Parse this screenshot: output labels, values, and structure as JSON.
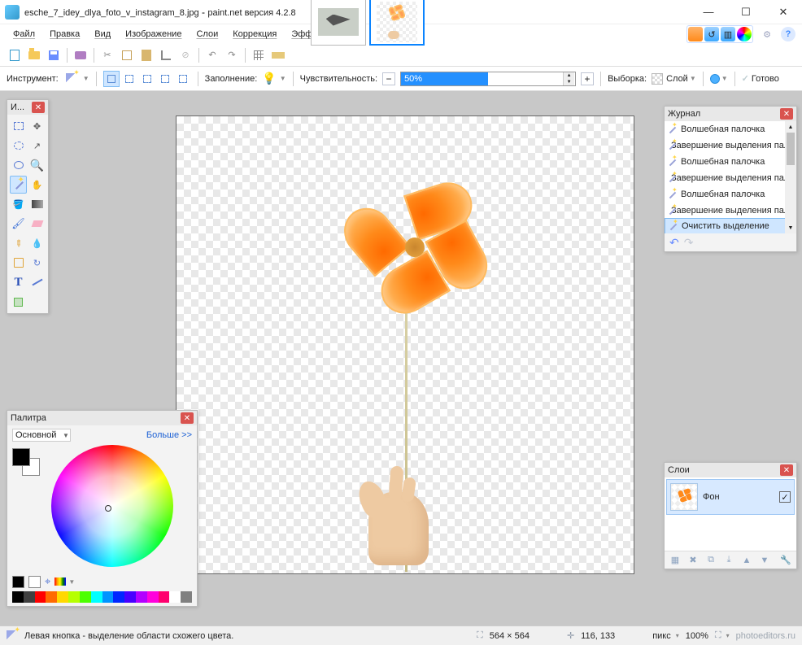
{
  "titlebar": {
    "filename": "esche_7_idey_dlya_foto_v_instagram_8.jpg",
    "app": "paint.net версия 4.2.8"
  },
  "menu": {
    "file": "Файл",
    "edit": "Правка",
    "view": "Вид",
    "image": "Изображение",
    "layers": "Слои",
    "correction": "Коррекция",
    "effects": "Эффекты"
  },
  "options": {
    "tool_label": "Инструмент:",
    "fill_label": "Заполнение:",
    "tolerance_label": "Чувствительность:",
    "tolerance_value": "50%",
    "tolerance_fill_pct": 50,
    "sampling_label": "Выборка:",
    "sampling_value": "Слой",
    "commit": "Готово"
  },
  "tools_panel": {
    "title": "И..."
  },
  "history": {
    "title": "Журнал",
    "items": [
      {
        "label": "Волшебная палочка"
      },
      {
        "label": "Завершение выделения палочкой",
        "sub": true
      },
      {
        "label": "Волшебная палочка"
      },
      {
        "label": "Завершение выделения палочкой",
        "sub": true
      },
      {
        "label": "Волшебная палочка"
      },
      {
        "label": "Завершение выделения палочкой",
        "sub": true
      },
      {
        "label": "Очистить выделение",
        "selected": true
      }
    ]
  },
  "palette": {
    "title": "Палитра",
    "primary_type": "Основной",
    "more": "Больше >>",
    "swatches": [
      "#000",
      "#404040",
      "#ff0000",
      "#ff6a00",
      "#ffd800",
      "#b6ff00",
      "#4cff00",
      "#00ffff",
      "#0094ff",
      "#0026ff",
      "#4800ff",
      "#b200ff",
      "#ff00dc",
      "#ff006e",
      "#ffffff",
      "#808080"
    ]
  },
  "layers": {
    "title": "Слои",
    "items": [
      {
        "label": "Фон",
        "visible": true
      }
    ]
  },
  "status": {
    "hint": "Левая кнопка - выделение области схожего цвета.",
    "dims_label": "564 × 564",
    "cursor_label": "116, 133",
    "units": "пикс",
    "zoom": "100%",
    "watermark": "photoeditors.ru"
  }
}
